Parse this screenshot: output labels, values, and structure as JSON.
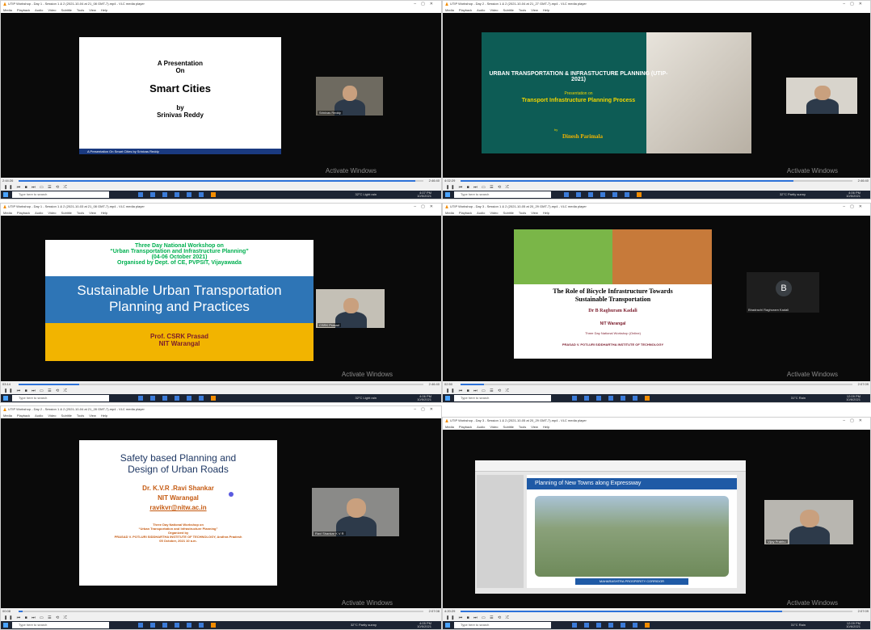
{
  "windows": [
    {
      "title": "UTIP Workshop - Day 1 - Session 1 & 2 (2021-10-04 at 21_08 GMT-7).mp4 - VLC media player",
      "menu": [
        "Media",
        "Playback",
        "Audio",
        "Video",
        "Subtitle",
        "Tools",
        "View",
        "Help"
      ],
      "time_elapsed": "2:44:26",
      "time_total": "2:46:40",
      "progress": 0.98,
      "slide": {
        "l1": "A Presentation",
        "l2": "On",
        "l3": "Smart Cities",
        "l4": "by",
        "l5": "Srinivas Reddy",
        "footer": "A Presentation On Smart Cities by Srinivas Reddy"
      },
      "cam_label": "Srinivas Reddy",
      "activate": "Activate Windows",
      "weather": "32°C Light rain",
      "clock_time": "4:07 PM",
      "clock_date": "10/5/2021"
    },
    {
      "title": "UTIP Workshop - Day 2 - Session 1 & 2 (2021-10-04 at 21_27 GMT-7).mp4 - VLC media player",
      "menu": [
        "Media",
        "Playback",
        "Audio",
        "Video",
        "Subtitle",
        "Tools",
        "View",
        "Help"
      ],
      "time_elapsed": "4:02:29",
      "time_total": "2:46:40",
      "progress": 0.85,
      "slide": {
        "l1": "URBAN TRANSPORTATION & INFRASTUCTURE PLANNING (UTIP-2021)",
        "l2": "Presentation on",
        "l3": "Transport Infrastructure Planning Process",
        "l4": "by",
        "l5": "Dinesh Parimala"
      },
      "cam_label": "",
      "activate": "Activate Windows",
      "weather": "32°C Partly sunny",
      "clock_time": "4:06 PM",
      "clock_date": "10/5/2021"
    },
    {
      "title": "UTIP Workshop - Day 1 - Session 1 & 2 (2021-10-03 at 21_08 GMT-7).mp4 - VLC media player",
      "menu": [
        "Media",
        "Playback",
        "Audio",
        "Video",
        "Subtitle",
        "Tools",
        "View",
        "Help"
      ],
      "time_elapsed": "03:14",
      "time_total": "2:46:40",
      "progress": 0.15,
      "slide": {
        "l1": "Three Day National Workshop on",
        "l2": "“Urban Transportation and Infrastructure Planning”",
        "l3": "(04-06 October 2021)",
        "l4": "Organised by Dept. of CE, PVPSIT, Vijayawada",
        "l5": "Sustainable Urban Transportation",
        "l6": "Planning and Practices",
        "l7": "Prof. CSRK Prasad",
        "l8": "NIT Warangal"
      },
      "cam_label": "CSRK Prasad",
      "activate": "Activate Windows",
      "weather": "32°C Light rain",
      "clock_time": "4:06 PM",
      "clock_date": "10/5/2021"
    },
    {
      "title": "UTIP Workshop - Day 3 - Session 1 & 2 (2021-10-05 at 20_29 GMT-7).mp4 - VLC media player",
      "menu": [
        "Media",
        "Playback",
        "Audio",
        "Video",
        "Subtitle",
        "Tools",
        "View",
        "Help"
      ],
      "time_elapsed": "02:50",
      "time_total": "2:07:09",
      "progress": 0.06,
      "slide": {
        "l1": "The Role of Bicycle Infrastructure Towards",
        "l2": "Sustainable Transportation",
        "l3": "Dr B Raghuram Kadali",
        "l4": "NIT Warangal",
        "l5": "Three Day National Workshop (Online)",
        "l6": "PRASAD V. POTLURI SIDDHARTHA INSTITUTE OF TECHNOLOGY"
      },
      "cam_label": "Bhadrachi Raghuram Kadali",
      "avatar_letter": "B",
      "activate": "Activate Windows",
      "weather": "31°C Rain",
      "clock_time": "12:09 PM",
      "clock_date": "10/6/2021"
    },
    {
      "title": "UTIP Workshop - Day 2 - Session 1 & 2 (2021-10-04 at 21_28 GMT-7).mp4 - VLC media player",
      "menu": [
        "Media",
        "Playback",
        "Audio",
        "Video",
        "Subtitle",
        "Tools",
        "View",
        "Help"
      ],
      "time_elapsed": "00:08",
      "time_total": "2:07:08",
      "progress": 0.01,
      "slide": {
        "l1": "Safety based Planning and",
        "l2": "Design of Urban Roads",
        "l3": "Dr. K.V.R .Ravi Shankar",
        "l4": "NIT Warangal",
        "l5": "ravikvr@nitw.ac.in",
        "l6": "Three Day National Workshop on",
        "l7": "“Urban Transportation and Infrastructure Planning”",
        "l8": "Organized by",
        "l9": "PRASAD V. POTLURI SIDDHARTHA INSTITUTE OF TECHNOLOGY, Andhra Pradesh",
        "l10": "05 October, 2021 10 a.m."
      },
      "cam_label": "Ravi Shankar K V R",
      "activate": "Activate Windows",
      "weather": "32°C Partly sunny",
      "clock_time": "4:05 PM",
      "clock_date": "10/5/2021"
    },
    {
      "title": "UTIP Workshop - Day 3 - Session 1 & 2 (2021-10-05 at 20_29 GMT-7).mp4 - VLC media player",
      "menu": [
        "Media",
        "Playback",
        "Audio",
        "Video",
        "Subtitle",
        "Tools",
        "View",
        "Help"
      ],
      "time_elapsed": "4:20:29",
      "time_total": "2:07:09",
      "progress": 0.82,
      "slide": {
        "l1": "Planning of New Towns along Expressway",
        "l2": "MAHARASHTRA PROSPERITY CORRIDOR"
      },
      "cam_label": "Vijay Prabhu",
      "activate": "Activate Windows",
      "weather": "31°C Rain",
      "clock_time": "12:09 PM",
      "clock_date": "10/6/2021"
    }
  ],
  "taskbar_search": "Type here to search",
  "colors": {
    "vlc": "#f28c00",
    "seek": "#2d72d9",
    "taskbar": "#1c2433",
    "green_text": "#00b050",
    "blue_band": "#2e75b6",
    "gold_band": "#f2b400",
    "maroon": "#7b1c2c"
  }
}
